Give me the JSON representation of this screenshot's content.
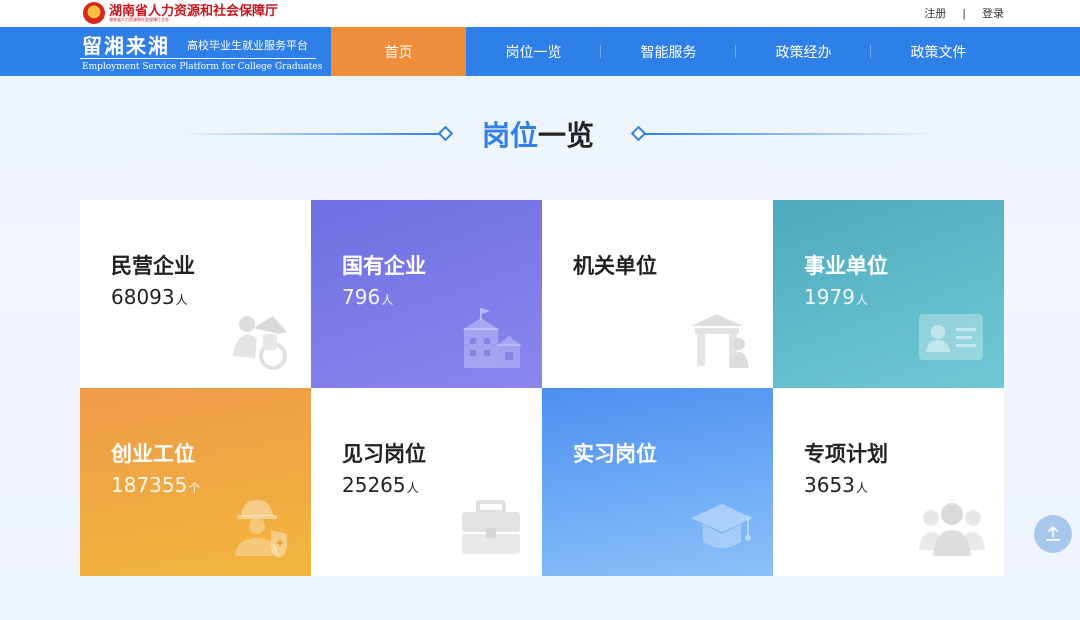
{
  "header": {
    "gov_name": "湖南省人力资源和社会保障厅",
    "gov_sub": "湖南省人力资源和社会保障厅主办",
    "register": "注册",
    "separator": "|",
    "login": "登录"
  },
  "brand": {
    "main": "留湘来湘",
    "side": "高校毕业生就业服务平台",
    "english": "Employment Service Platform for College Graduates"
  },
  "nav": {
    "items": [
      "首页",
      "岗位一览",
      "智能服务",
      "政策经办",
      "政策文件"
    ],
    "active": "首页"
  },
  "section": {
    "title_highlight": "岗位",
    "title_rest": "一览"
  },
  "cards": [
    {
      "name": "民营企业",
      "count": "68093",
      "unit": "人",
      "icon": "workers-icon"
    },
    {
      "name": "国有企业",
      "count": "796",
      "unit": "人",
      "icon": "building-icon"
    },
    {
      "name": "机关单位",
      "count": "",
      "unit": "",
      "icon": "government-officer-icon"
    },
    {
      "name": "事业单位",
      "count": "1979",
      "unit": "人",
      "icon": "id-card-icon"
    },
    {
      "name": "创业工位",
      "count": "187355",
      "unit": "个",
      "icon": "helmet-worker-icon"
    },
    {
      "name": "见习岗位",
      "count": "25265",
      "unit": "人",
      "icon": "toolbox-icon"
    },
    {
      "name": "实习岗位",
      "count": "",
      "unit": "",
      "icon": "graduation-cap-icon"
    },
    {
      "name": "专项计划",
      "count": "3653",
      "unit": "人",
      "icon": "group-icon"
    }
  ],
  "colors": {
    "primary": "#2f7fe8",
    "active_nav": "#f08d3b",
    "gov_red": "#c8161d"
  }
}
